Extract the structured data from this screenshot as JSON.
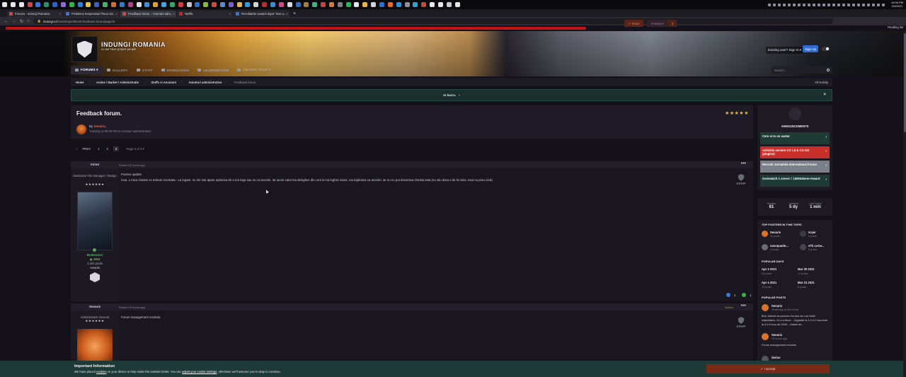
{
  "taskbar": {
    "icons": [
      "#e6e6ea",
      "#e6e6ea",
      "#e6e6ea",
      "#d04545",
      "#3b73d6",
      "#2f8d6a",
      "#2b62c4",
      "#8b6cd8",
      "#30b44a",
      "#2f7fd6",
      "#e7c53a",
      "#3b5fc8",
      "#40b36a",
      "#d96b2a",
      "#2a7bd0",
      "#b63a8a",
      "#e0e0e6",
      "#3f8fd4",
      "#d8a030",
      "#44a4d8",
      "#3aa36b",
      "#d23b3b",
      "#c6c6cc",
      "#2e6fd2",
      "#8ab83a",
      "#d4483a",
      "#5c88d8",
      "#7a5ad6",
      "#e6b64a",
      "#2f9ad4",
      "#d2d2d8",
      "#b03030",
      "#3a8ad0",
      "#c74b8a",
      "#d9d9df",
      "#2f6fbf",
      "#a67c3a",
      "#3eb489",
      "#c84040",
      "#d97a30",
      "#7f7f88",
      "#1db954",
      "#e6e6ea",
      "#e6b44a",
      "#d0d0d6",
      "#2f6fd2",
      "#e36a2a",
      "#2f8fd8",
      "#8f8f98",
      "#2aa3d8",
      "#c44a3a",
      "#e7e7ec",
      "#e6e6ea",
      "#c9c9cf",
      "#e6e6ea"
    ],
    "clock_time": "10:06 PM",
    "clock_date": "4/4/2021"
  },
  "tabs": [
    {
      "title": "Forums - Indungi Romania",
      "color": "#d04545"
    },
    {
      "title": "Probleme temperaturi Placa vid...",
      "color": "#3b73d6"
    },
    {
      "title": "Feedback forum. - Anunturi adm...",
      "color": "#d04545"
    },
    {
      "title": "Netflix",
      "color": "#d81f26"
    },
    {
      "title": "Rezultatele cautarii dupa \"new u...",
      "color": "#3b73d6"
    }
  ],
  "address": {
    "domain": "indungi.ro",
    "path": "/forum/topic/86420-feedback-forum/page/3/",
    "reading_list": "Reading list"
  },
  "header": {
    "site_name": "INDUNGI ROMANIA",
    "slogan": "cu we have proper people",
    "sign_in": "Existing user? Sign In ▾",
    "sign_up": "Sign Up"
  },
  "nav": {
    "items": [
      {
        "label": "Forums ▾",
        "active": true
      },
      {
        "label": "Gallery",
        "active": false
      },
      {
        "label": "Staff",
        "active": false
      },
      {
        "label": "Downloads",
        "active": false
      },
      {
        "label": "Leaderboard",
        "active": false
      },
      {
        "label": "Indungi Shop ▾",
        "active": false
      }
    ],
    "search_placeholder": "Search..."
  },
  "breadcrumb": {
    "items": [
      "Home",
      "Anime / Market / Administratie",
      "Staffs si Anuntare",
      "Anunturi administrative",
      "Feedback forum."
    ],
    "all_activity": "All Activity"
  },
  "announcement": {
    "text": "In lucru.",
    "close": "×"
  },
  "topic": {
    "title": "Feedback forum.",
    "stars": "★★★★★",
    "by_prefix": "By",
    "author": "Senaris,",
    "meta": "Tuesday at 08:39 PM in Anunturi administrative",
    "share": "Share",
    "follow": "Followers",
    "follow_count": "3"
  },
  "pagination": {
    "prev": "PREV",
    "pages": [
      "1",
      "2",
      "3"
    ],
    "current": "3",
    "page_of": "Page 3 of 3 ▾"
  },
  "posts": [
    {
      "author": "Victor",
      "date": "Posted 20 hours ago",
      "rank": "Moderator File Manager / Design",
      "rank_stars": "★★★★★★",
      "group": "Moderators",
      "points": "1954",
      "posts_count": "3,250 posts",
      "awards_label": "Awards",
      "title_line": "Frumos update.",
      "body": "Insa, o mica chestie ce trebuie rezolvata - La logare, nu imi mai apare optiunea de a ma loga sau nu ca anonim, iar acum cand ma deloghez din cont si ma loghez iarasi, ma logheaza ca anonim, iar eu nu pot dezactiva chestia asta (nu stiu daca e de la mine, insa nu prea cred)",
      "staff": "STAFF",
      "reactions": [
        {
          "count": "2",
          "color": "#3a7bd5"
        },
        {
          "count": "1",
          "color": "#3fae4a"
        }
      ]
    },
    {
      "author": "Senaris",
      "date": "Posted 19 hours ago",
      "rank": "Administrator General",
      "rank_stars": "★★★★★★",
      "role_tag": "Author",
      "title_line": "Forum management recolvat.",
      "staff": "STAFF"
    }
  ],
  "sidebar": {
    "announcements_title": "ANNOUNCEMENTS",
    "announcements": [
      {
        "label": "Cere si tu un avatar",
        "color": "#1f3b36"
      },
      {
        "label": "Achizitie servere CS 1.6 & CS:GO (plugins)",
        "color": "#c9302c"
      },
      {
        "label": "Recrutii Jurnaliste International Forum",
        "color": "#7b7f88"
      },
      {
        "label": "Overwatch 1 cerere = 1000tokens+Award",
        "color": "#1f3b36"
      }
    ],
    "stats": [
      {
        "label": "Replies",
        "value": "61"
      },
      {
        "label": "Created",
        "value": "5 dy"
      },
      {
        "label": "Last Reply",
        "value": "1 min"
      }
    ],
    "top_posters_title": "TOP POSTERS IN THIS TOPIC",
    "top_posters": [
      {
        "name": "Senaris",
        "count": "11 posts",
        "color": "#d9742e"
      },
      {
        "name": "Kojer",
        "count": "4 posts",
        "color": "#3a3a44"
      },
      {
        "name": "vanoquade...",
        "count": "4 posts",
        "color": "#6b6b74"
      },
      {
        "name": "eTh LeGe...",
        "count": "3 posts",
        "color": "#44444e"
      }
    ],
    "popular_days_title": "POPULAR DAYS",
    "popular_days": [
      {
        "date": "Apr 3 2021",
        "count": "24 posts"
      },
      {
        "date": "Mar 30 2021",
        "count": "17 posts"
      },
      {
        "date": "Apr 4 2021",
        "count": "10 posts"
      },
      {
        "date": "Mar 31 2021",
        "count": "6 posts"
      }
    ],
    "popular_posts_title": "POPULAR POSTS",
    "popular_posts": [
      {
        "name": "Senaris",
        "date": "Yesterday at 08:16 AM",
        "excerpt": "Bun, trebuie sa pornesc forumu ca v-au fostit majoritatea.    Ce s-a facut: - Upgrade la 4.5.4.2 insa este la 4.4.5 inca din 2016. - Alatuir de..."
      },
      {
        "name": "Senaris",
        "date": "19 hours ago",
        "excerpt": "Forum management recolvat."
      },
      {
        "name": "darius",
        "date": "",
        "excerpt": ""
      }
    ]
  },
  "cookie": {
    "title": "Important Information",
    "text_a": "We have placed",
    "link1": "cookies",
    "text_b": "on your device to help make this website better. You can",
    "link2": "adjust your cookie settings",
    "text_c": ", otherwise we'll assume you're okay to continue.",
    "accept": "✓  I accept"
  }
}
